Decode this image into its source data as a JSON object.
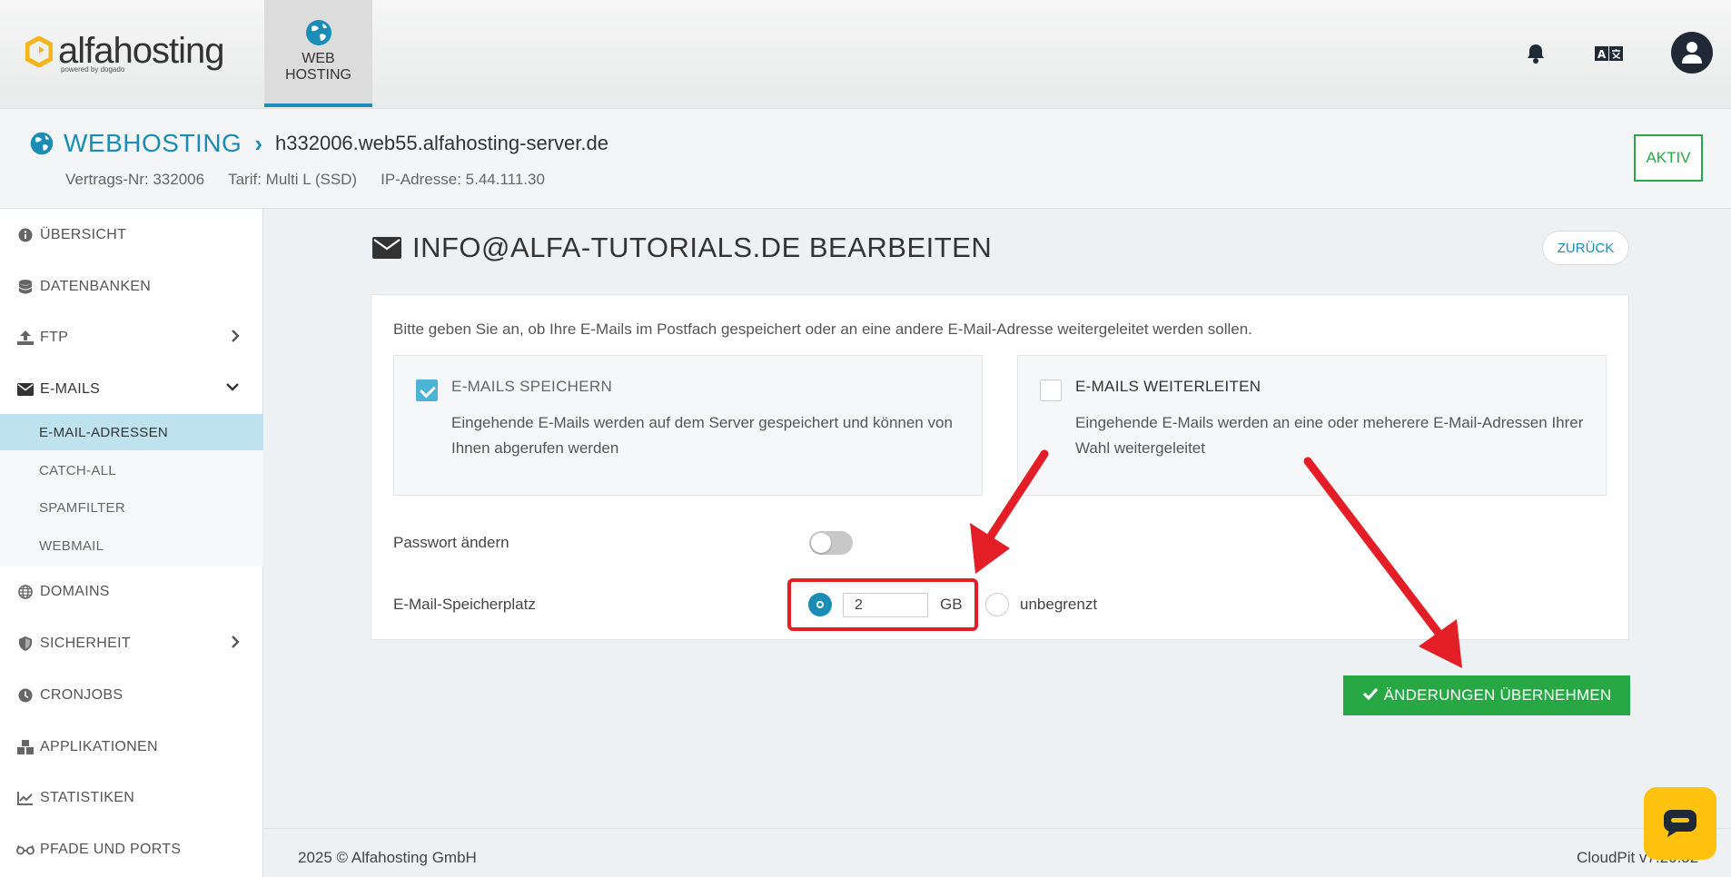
{
  "brand": {
    "name": "alfahosting",
    "sub": "powered by dogado",
    "accent": "#1a8cb5",
    "success": "#27a844"
  },
  "topnav": {
    "tab_line1": "WEB",
    "tab_line2": "HOSTING"
  },
  "header": {
    "section": "WEBHOSTING",
    "host": "h332006.web55.alfahosting-server.de",
    "contract": "Vertrags-Nr: 332006",
    "tariff": "Tarif: Multi L (SSD)",
    "ip": "IP-Adresse: 5.44.111.30",
    "status": "AKTIV"
  },
  "sidebar": {
    "items": [
      {
        "label": "ÜBERSICHT",
        "icon": "info-icon"
      },
      {
        "label": "DATENBANKEN",
        "icon": "database-icon"
      },
      {
        "label": "FTP",
        "icon": "upload-icon"
      },
      {
        "label": "E-MAILS",
        "icon": "envelope-icon"
      },
      {
        "label": "DOMAINS",
        "icon": "globe-icon"
      },
      {
        "label": "SICHERHEIT",
        "icon": "shield-icon"
      },
      {
        "label": "CRONJOBS",
        "icon": "clock-icon"
      },
      {
        "label": "APPLIKATIONEN",
        "icon": "cubes-icon"
      },
      {
        "label": "STATISTIKEN",
        "icon": "chart-icon"
      },
      {
        "label": "PFADE UND PORTS",
        "icon": "glasses-icon"
      }
    ],
    "subitems": [
      {
        "label": "E-MAIL-ADRESSEN"
      },
      {
        "label": "CATCH-ALL"
      },
      {
        "label": "SPAMFILTER"
      },
      {
        "label": "WEBMAIL"
      }
    ]
  },
  "main": {
    "title": "INFO@ALFA-TUTORIALS.DE BEARBEITEN",
    "back": "ZURÜCK",
    "intro": "Bitte geben Sie an, ob Ihre E-Mails im Postfach gespeichert oder an eine andere E-Mail-Adresse weitergeleitet werden sollen.",
    "option_store": {
      "title": "E-MAILS SPEICHERN",
      "desc": "Eingehende E-Mails werden auf dem Server gespeichert und können von Ihnen abgerufen werden"
    },
    "option_forward": {
      "title": "E-MAILS WEITERLEITEN",
      "desc": "Eingehende E-Mails werden an eine oder meherere E-Mail-Adressen Ihrer Wahl weitergeleitet"
    },
    "password_label": "Passwort ändern",
    "storage_label": "E-Mail-Speicherplatz",
    "storage_value": "2",
    "storage_unit": "GB",
    "unlimited": "unbegrenzt",
    "submit": "ÄNDERUNGEN ÜBERNEHMEN"
  },
  "footer": {
    "copyright": "2025 © Alfahosting GmbH",
    "version": "CloudPit v7.20.52"
  }
}
